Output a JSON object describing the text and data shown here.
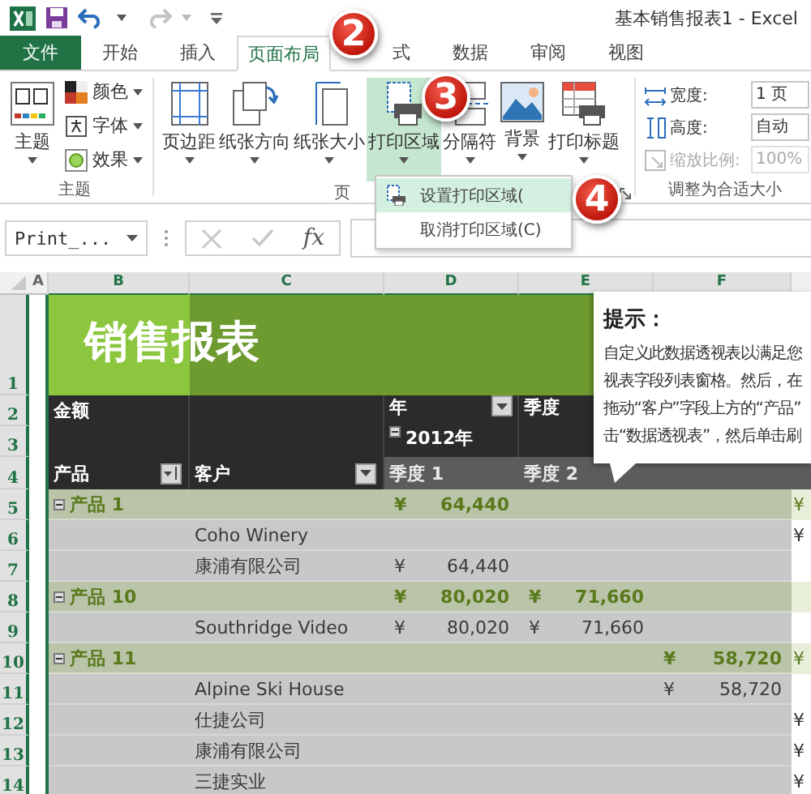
{
  "app": {
    "title": "基本销售报表1 - Excel",
    "redo_disabled": true
  },
  "tabs": [
    {
      "label": "文件",
      "kind": "file",
      "selected": false
    },
    {
      "label": "开始",
      "kind": "tab",
      "selected": false
    },
    {
      "label": "插入",
      "kind": "tab",
      "selected": false
    },
    {
      "label": "页面布局",
      "kind": "tab",
      "selected": true
    },
    {
      "label": "式",
      "kind": "tab",
      "selected": false
    },
    {
      "label": "数据",
      "kind": "tab",
      "selected": false
    },
    {
      "label": "审阅",
      "kind": "tab",
      "selected": false
    },
    {
      "label": "视图",
      "kind": "tab",
      "selected": false
    }
  ],
  "ribbon": {
    "theme_group": {
      "label": "主题",
      "button": "主题",
      "options": [
        {
          "label": "颜色",
          "kind": "colors"
        },
        {
          "label": "字体",
          "kind": "fonts"
        },
        {
          "label": "效果",
          "kind": "effects"
        }
      ]
    },
    "page_group": {
      "label": "页",
      "buttons": [
        {
          "label": "页边距",
          "kind": "margins",
          "selected": false
        },
        {
          "label": "纸张方向",
          "kind": "orientation",
          "selected": false
        },
        {
          "label": "纸张大小",
          "kind": "size",
          "selected": false
        },
        {
          "label": "打印区域",
          "kind": "print_area",
          "selected": true
        },
        {
          "label": "分隔符",
          "kind": "breaks",
          "selected": false
        },
        {
          "label": "背景",
          "kind": "background",
          "selected": false
        },
        {
          "label": "打印标题",
          "kind": "print_titles",
          "selected": false
        }
      ]
    },
    "scale_group": {
      "label": "调整为合适大小",
      "fields": [
        {
          "label": "宽度:",
          "value": "1 页",
          "kind": "width",
          "disabled": false
        },
        {
          "label": "高度:",
          "value": "自动",
          "kind": "height",
          "disabled": false
        },
        {
          "label": "缩放比例:",
          "value": "100%",
          "kind": "scale",
          "disabled": true
        }
      ]
    }
  },
  "menu": {
    "items": [
      {
        "label": "设置打印区域(",
        "selected": true
      },
      {
        "label": "取消打印区域(C)",
        "selected": false
      }
    ]
  },
  "formula_bar": {
    "name_box": "Print_...",
    "function_label": "fx"
  },
  "sheet": {
    "columns": [
      "A",
      "B",
      "C",
      "D",
      "E",
      "F"
    ],
    "rows": [
      {
        "number": "1",
        "kind": "title",
        "title": "销售报表"
      },
      {
        "number": "2",
        "kind": "header",
        "b": {
          "text": "金额"
        },
        "d": {
          "text": "年",
          "filter": true,
          "sorted": false
        },
        "e": {
          "text": "季度"
        }
      },
      {
        "number": "3",
        "kind": "header",
        "d": {
          "text": "2012年",
          "expanded": true
        }
      },
      {
        "number": "4",
        "kind": "fieldheader",
        "b": {
          "text": "产品",
          "filter": true,
          "sorted": true
        },
        "c": {
          "text": "客户",
          "filter": true,
          "sorted": false
        },
        "d": {
          "text": "季度 1"
        },
        "e": {
          "text": "季度 2"
        }
      },
      {
        "number": "5",
        "kind": "group",
        "b": {
          "text": "产品 1",
          "expanded": true
        },
        "d": {
          "currency": "¥",
          "amount": "64,440"
        },
        "g": {
          "currency": "¥"
        }
      },
      {
        "number": "6",
        "kind": "item",
        "c": {
          "text": "Coho Winery"
        },
        "g": {
          "currency": "¥"
        }
      },
      {
        "number": "7",
        "kind": "item",
        "c": {
          "text": "康浦有限公司"
        },
        "d": {
          "currency": "¥",
          "amount": "64,440"
        }
      },
      {
        "number": "8",
        "kind": "group",
        "b": {
          "text": "产品 10",
          "expanded": true
        },
        "d": {
          "currency": "¥",
          "amount": "80,020"
        },
        "e": {
          "currency": "¥",
          "amount": "71,660"
        }
      },
      {
        "number": "9",
        "kind": "item",
        "c": {
          "text": "Southridge Video"
        },
        "d": {
          "currency": "¥",
          "amount": "80,020"
        },
        "e": {
          "currency": "¥",
          "amount": "71,660"
        }
      },
      {
        "number": "10",
        "kind": "group",
        "b": {
          "text": "产品 11",
          "expanded": true
        },
        "f": {
          "currency": "¥",
          "amount": "58,720"
        },
        "g": {
          "currency": "¥"
        }
      },
      {
        "number": "11",
        "kind": "item",
        "c": {
          "text": "Alpine Ski House"
        },
        "f": {
          "currency": "¥",
          "amount": "58,720"
        }
      },
      {
        "number": "12",
        "kind": "item",
        "c": {
          "text": "仕捷公司"
        },
        "g": {
          "currency": "¥"
        }
      },
      {
        "number": "13",
        "kind": "item",
        "c": {
          "text": "康浦有限公司"
        },
        "g": {
          "currency": "¥"
        }
      },
      {
        "number": "14",
        "kind": "item",
        "c": {
          "text": "三捷实业"
        },
        "g": {
          "currency": "¥"
        }
      }
    ]
  },
  "tooltip": {
    "title": "提示：",
    "lines": [
      "自定义此数据透视表以满足您",
      "视表字段列表窗格。然后，在",
      "拖动“客户”字段上方的“产品”",
      "击“数据透视表”，然后单击刷"
    ]
  },
  "markers": [
    {
      "label": "2"
    },
    {
      "label": "3"
    },
    {
      "label": "4"
    }
  ]
}
